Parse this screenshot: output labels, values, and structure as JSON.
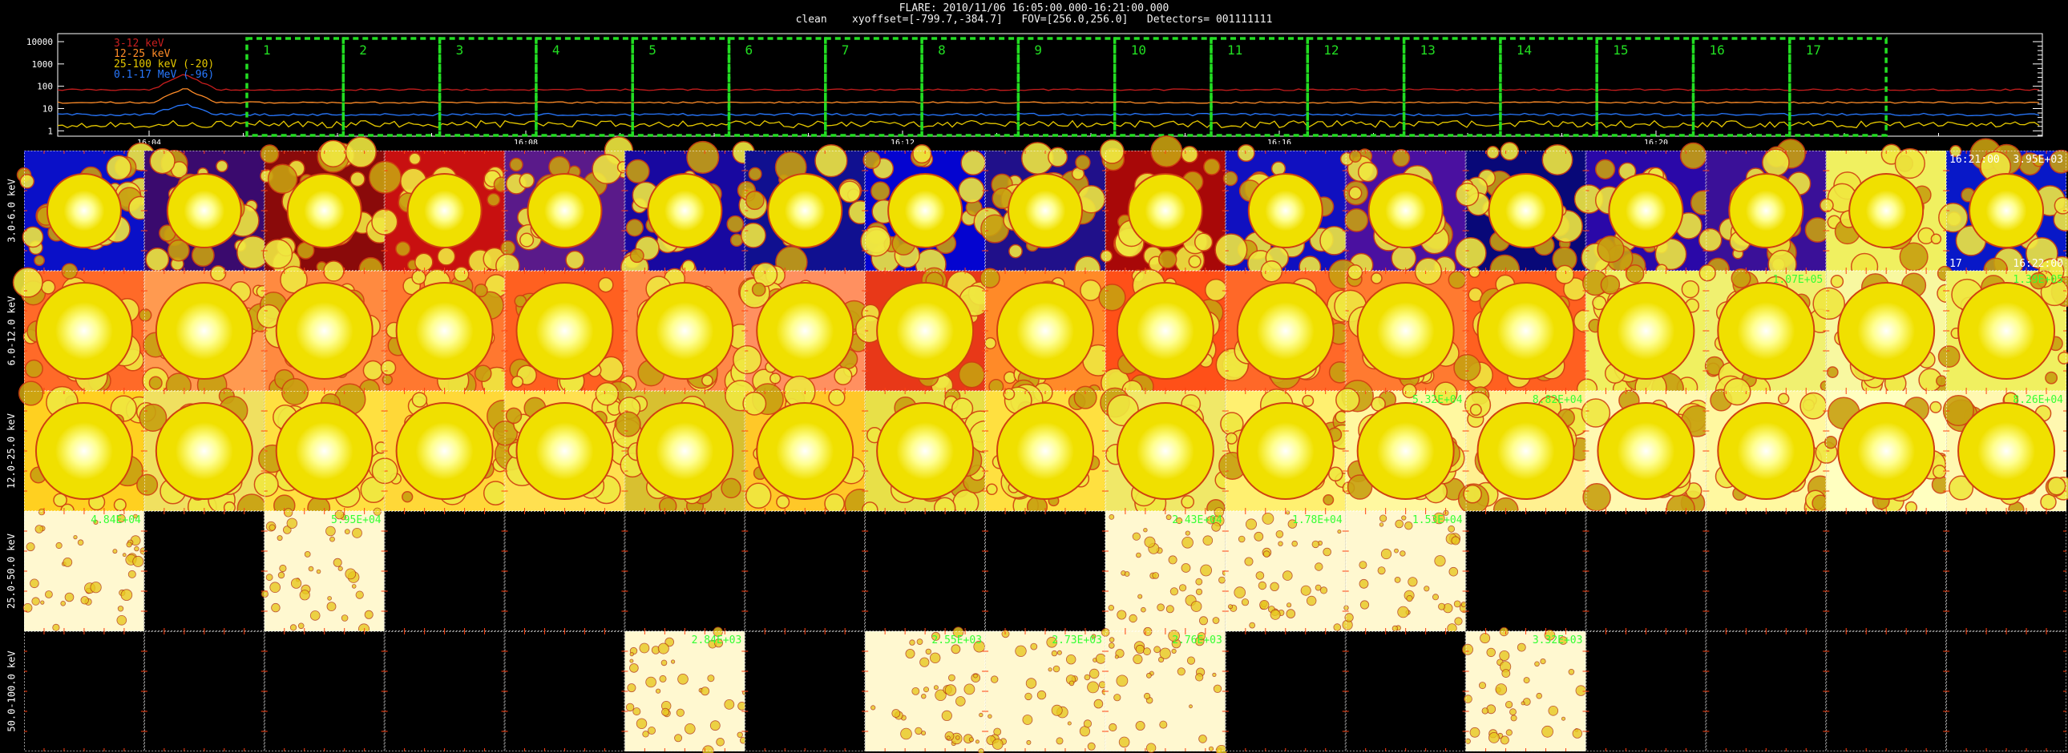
{
  "header": {
    "line1": "FLARE: 2010/11/06 16:05:00.000-16:21:00.000",
    "line2": "clean    xyoffset=[-799.7,-384.7]   FOV=[256.0,256.0]   Detectors= 001111111"
  },
  "lightcurve": {
    "y_ticks": [
      "10000",
      "1000",
      "100",
      "10",
      "1"
    ],
    "x_ticks": [
      "16:04",
      "16:08",
      "16:12",
      "16:16",
      "16:20"
    ],
    "legend": [
      {
        "label": "3-12 keV",
        "color": "#c81e1e"
      },
      {
        "label": "12-25 keV",
        "color": "#ff8c28"
      },
      {
        "label": "25-100 keV (-20)",
        "color": "#e6c800"
      },
      {
        "label": "0.1-17 MeV (-96)",
        "color": "#2878ff"
      }
    ],
    "intervals": [
      "1",
      "2",
      "3",
      "4",
      "5",
      "6",
      "7",
      "8",
      "9",
      "10",
      "11",
      "12",
      "13",
      "14",
      "15",
      "16",
      "17"
    ],
    "interval_color": "#22dd22"
  },
  "image_grid": {
    "rows": [
      {
        "label": "3.0-6.0 keV",
        "texts": [
          {
            "col": 16,
            "pos": "tl",
            "text": "16:21:00",
            "color": "#ffffff"
          },
          {
            "col": 16,
            "pos": "tr",
            "text": "3.95E+03",
            "color": "#ffffff"
          },
          {
            "col": 16,
            "pos": "bl",
            "text": "17",
            "color": "#ffffff"
          },
          {
            "col": 16,
            "pos": "br",
            "text": "16:22:00",
            "color": "#ffffff"
          }
        ]
      },
      {
        "label": "6.0-12.0 keV",
        "texts": [
          {
            "col": 14,
            "pos": "tr",
            "text": "1.07E+05",
            "color": "#33ff33"
          },
          {
            "col": 16,
            "pos": "tr",
            "text": "1.39E+05",
            "color": "#33ff33"
          }
        ]
      },
      {
        "label": "12.0-25.0 keV",
        "texts": [
          {
            "col": 11,
            "pos": "tr",
            "text": "5.32E+04",
            "color": "#33ff33"
          },
          {
            "col": 12,
            "pos": "tr",
            "text": "8.82E+04",
            "color": "#33ff33"
          },
          {
            "col": 16,
            "pos": "tr",
            "text": "8.26E+04",
            "color": "#33ff33"
          }
        ]
      },
      {
        "label": "25.0-50.0 keV",
        "texts": [
          {
            "col": 0,
            "pos": "tr",
            "text": "4.84E+04",
            "color": "#33ff33"
          },
          {
            "col": 2,
            "pos": "tr",
            "text": "5.95E+04",
            "color": "#33ff33"
          },
          {
            "col": 9,
            "pos": "tr",
            "text": "2.43E+04",
            "color": "#33ff33"
          },
          {
            "col": 10,
            "pos": "tr",
            "text": "1.78E+04",
            "color": "#33ff33"
          },
          {
            "col": 11,
            "pos": "tr",
            "text": "1.53E+04",
            "color": "#33ff33"
          }
        ]
      },
      {
        "label": "50.0-100.0 keV",
        "texts": [
          {
            "col": 5,
            "pos": "tr",
            "text": "2.84E+03",
            "color": "#33ff33"
          },
          {
            "col": 7,
            "pos": "tr",
            "text": "2.55E+03",
            "color": "#33ff33"
          },
          {
            "col": 8,
            "pos": "tr",
            "text": "2.73E+03",
            "color": "#33ff33"
          },
          {
            "col": 9,
            "pos": "tr",
            "text": "2.76E+03",
            "color": "#33ff33"
          },
          {
            "col": 12,
            "pos": "tr",
            "text": "3.32E+03",
            "color": "#33ff33"
          }
        ]
      }
    ],
    "columns": 17,
    "blank_tiles": [
      [],
      [],
      [],
      [
        1,
        3,
        4,
        5,
        6,
        7,
        8,
        12,
        13,
        14,
        15,
        16
      ],
      [
        0,
        1,
        2,
        3,
        4,
        6,
        10,
        11,
        13,
        14,
        15,
        16
      ]
    ],
    "palettes": {
      "row0": [
        "#0a10c8",
        "#3a0a6e",
        "#8a0a0a",
        "#c81010",
        "#5a1a8a",
        "#1808a0",
        "#101090",
        "#0404d0",
        "#20108a",
        "#a80808",
        "#1010c0",
        "#4a10a0",
        "#080878",
        "#2a08a8",
        "#3a1098",
        "#f0f060",
        "#0818c8"
      ],
      "row1": [
        "#ff6a28",
        "#ff9a50",
        "#ff8a40",
        "#ff7830",
        "#ff6020",
        "#ff8848",
        "#ff9060",
        "#e83818",
        "#ff8a28",
        "#ff5018",
        "#ff6828",
        "#ff7a30",
        "#ff6020",
        "#f0f060",
        "#f0f070",
        "#f8f8a0",
        "#f0f060"
      ],
      "row2": [
        "#ffd020",
        "#f0e060",
        "#ffe040",
        "#ffd838",
        "#ffe050",
        "#d8c030",
        "#ffc828",
        "#e8e048",
        "#ffe040",
        "#f0e868",
        "#fff070",
        "#fff8a0",
        "#fff090",
        "#fff8b0",
        "#fff8a0",
        "#ffffc0",
        "#fff8b0"
      ]
    }
  }
}
